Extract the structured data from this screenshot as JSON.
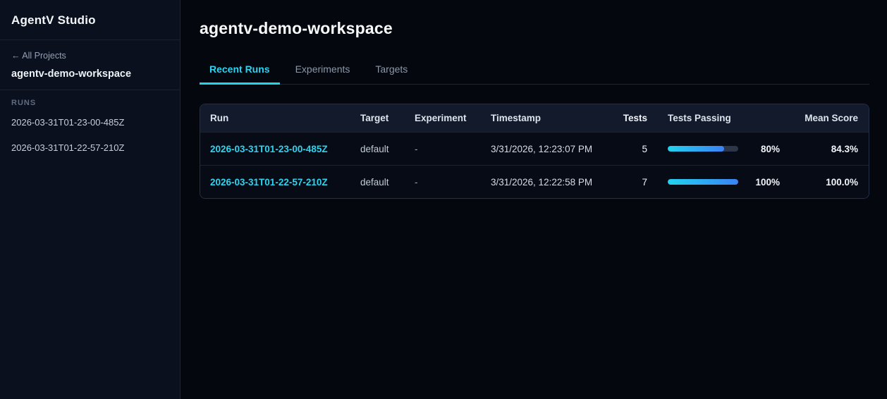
{
  "app": {
    "title": "AgentV Studio"
  },
  "sidebar": {
    "back_link": "← All Projects",
    "workspace_name": "agentv-demo-workspace",
    "runs_label": "RUNS",
    "runs": [
      "2026-03-31T01-23-00-485Z",
      "2026-03-31T01-22-57-210Z"
    ]
  },
  "main": {
    "title": "agentv-demo-workspace",
    "tabs": [
      {
        "label": "Recent Runs",
        "active": true
      },
      {
        "label": "Experiments",
        "active": false
      },
      {
        "label": "Targets",
        "active": false
      }
    ],
    "table": {
      "columns": {
        "run": "Run",
        "target": "Target",
        "experiment": "Experiment",
        "timestamp": "Timestamp",
        "tests": "Tests",
        "tests_passing": "Tests Passing",
        "mean_score": "Mean Score"
      },
      "rows": [
        {
          "run": "2026-03-31T01-23-00-485Z",
          "target": "default",
          "experiment": "-",
          "timestamp": "3/31/2026, 12:23:07 PM",
          "tests": "5",
          "tests_passing_pct": 80,
          "tests_passing_label": "80%",
          "mean_score": "84.3%"
        },
        {
          "run": "2026-03-31T01-22-57-210Z",
          "target": "default",
          "experiment": "-",
          "timestamp": "3/31/2026, 12:22:58 PM",
          "tests": "7",
          "tests_passing_pct": 100,
          "tests_passing_label": "100%",
          "mean_score": "100.0%"
        }
      ]
    }
  },
  "colors": {
    "accent_cyan": "#22d3ee",
    "bar_gradient_start": "#22d3ee",
    "bar_gradient_end": "#3b82f6",
    "sidebar_bg": "#0a101d",
    "main_bg": "#05070f",
    "table_header_bg": "#121a2b"
  }
}
